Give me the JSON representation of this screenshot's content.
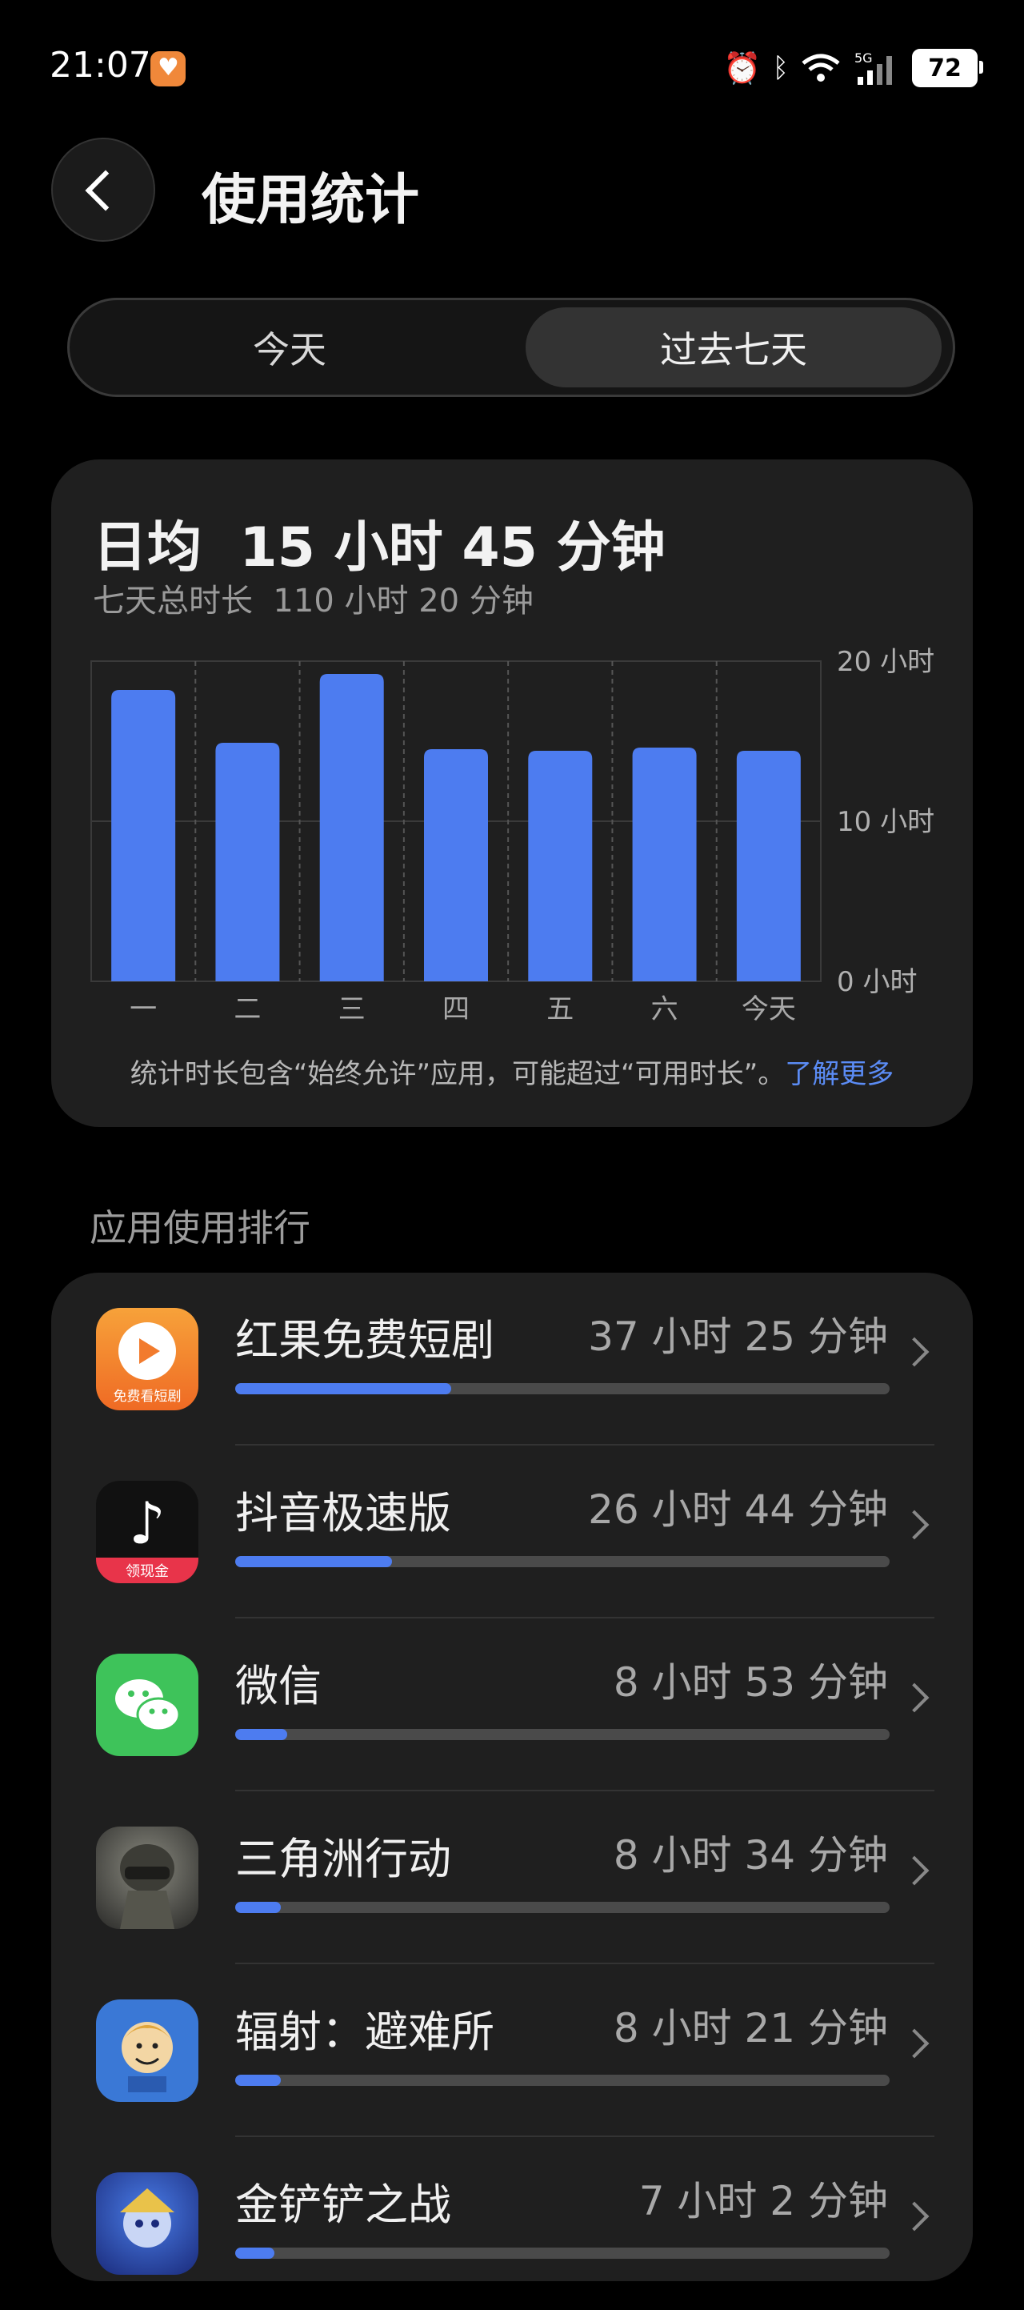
{
  "status_bar": {
    "time": "21:07",
    "battery": "72",
    "network": "5G"
  },
  "header": {
    "title": "使用统计"
  },
  "segmented": {
    "today": "今天",
    "past_week": "过去七天",
    "selected": "过去七天"
  },
  "summary": {
    "average": "日均  15 小时 45 分钟",
    "total": "七天总时长  110 小时 20 分钟",
    "note": "统计时长包含“始终允许”应用，可能超过“可用时长”。",
    "note_link": "了解更多"
  },
  "chart_data": {
    "type": "bar",
    "categories": [
      "一",
      "二",
      "三",
      "四",
      "五",
      "六",
      "今天"
    ],
    "values": [
      18.2,
      14.9,
      19.2,
      14.5,
      14.4,
      14.6,
      14.4
    ],
    "ylim": [
      0,
      20
    ],
    "y_ticks": [
      "0 小时",
      "10 小时",
      "20 小时"
    ],
    "color": "#4d7cf0",
    "grid": true
  },
  "ranking": {
    "title": "应用使用排行",
    "apps": [
      {
        "name": "红果免费短剧",
        "time": "37 小时 25 分钟",
        "share": 0.33,
        "icon": "hongguo-icon"
      },
      {
        "name": "抖音极速版",
        "time": "26 小时 44 分钟",
        "share": 0.24,
        "icon": "douyin-icon"
      },
      {
        "name": "微信",
        "time": "8 小时 53 分钟",
        "share": 0.08,
        "icon": "wechat-icon"
      },
      {
        "name": "三角洲行动",
        "time": "8 小时 34 分钟",
        "share": 0.07,
        "icon": "delta-force-icon"
      },
      {
        "name": "辐射：避难所",
        "time": "8 小时 21 分钟",
        "share": 0.07,
        "icon": "fallout-shelter-icon"
      },
      {
        "name": "金铲铲之战",
        "time": "7 小时 2 分钟",
        "share": 0.06,
        "icon": "jinchanchan-icon"
      }
    ],
    "icon_labels": {
      "hongguo": "免费看短剧",
      "douyin": "领现金"
    }
  }
}
